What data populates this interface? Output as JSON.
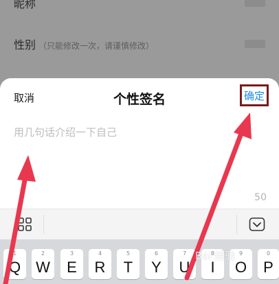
{
  "background": {
    "rows": [
      {
        "label": "昵称",
        "note": ""
      },
      {
        "label": "性别",
        "note": "（只能修改一次，请谨慎修改）"
      }
    ]
  },
  "sheet": {
    "cancel_label": "取消",
    "title": "个性签名",
    "confirm_label": "确定",
    "placeholder": "用几句话介绍一下自己",
    "char_count": "50"
  },
  "keyboard": {
    "keys": [
      {
        "num": "1",
        "ch": "Q"
      },
      {
        "num": "2",
        "ch": "W"
      },
      {
        "num": "3",
        "ch": "E"
      },
      {
        "num": "4",
        "ch": "R"
      },
      {
        "num": "5",
        "ch": "T"
      },
      {
        "num": "6",
        "ch": "Y"
      },
      {
        "num": "7",
        "ch": "U"
      },
      {
        "num": "8",
        "ch": "I"
      },
      {
        "num": "9",
        "ch": "O"
      },
      {
        "num": "0",
        "ch": "P"
      }
    ]
  },
  "watermark": "Bai 经验",
  "colors": {
    "accent": "#1d8ce0",
    "highlight_box": "#7a1a1a",
    "arrow": "#e8384f"
  }
}
